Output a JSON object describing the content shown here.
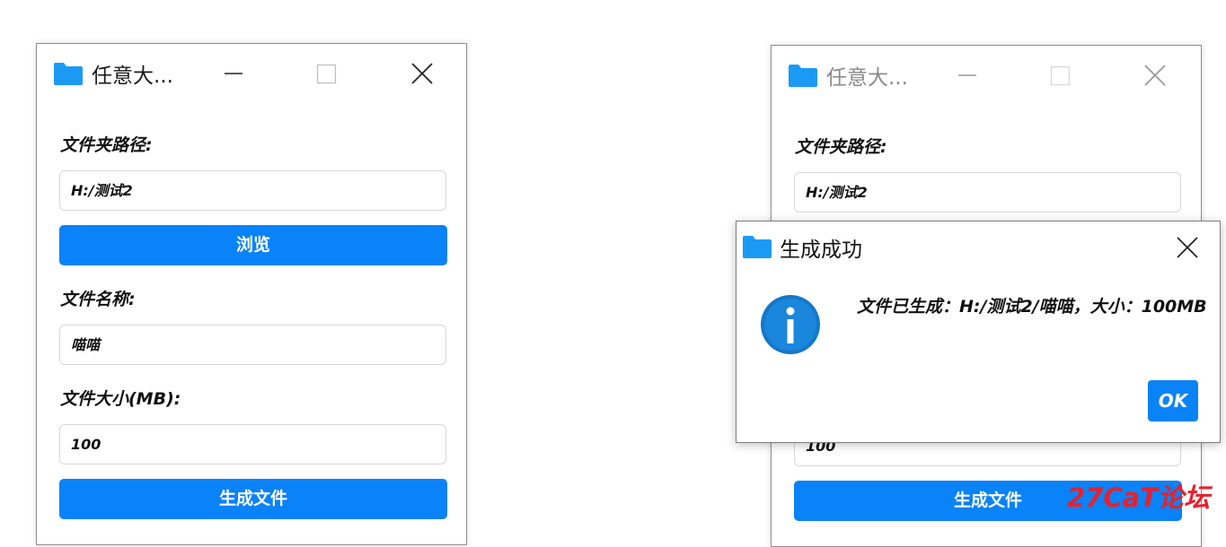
{
  "left_window": {
    "title": "任意大...",
    "folder_label": "文件夹路径:",
    "folder_value": "H:/测试2",
    "browse_button": "浏览",
    "name_label": "文件名称:",
    "name_value": "喵喵",
    "size_label": "文件大小(MB):",
    "size_value": "100",
    "generate_button": "生成文件"
  },
  "right_window": {
    "title": "任意大...",
    "folder_label": "文件夹路径:",
    "folder_value": "H:/测试2",
    "size_value": "100",
    "generate_button": "生成文件"
  },
  "dialog": {
    "title": "生成成功",
    "message": "文件已生成：H:/测试2/喵喵，大小：100MB",
    "ok_label": "OK"
  },
  "watermark": "27CaT论坛",
  "colors": {
    "accent": "#0a82f8",
    "folder": "#1b9af5",
    "info": "#1577c9",
    "watermark": "#e8202a"
  }
}
